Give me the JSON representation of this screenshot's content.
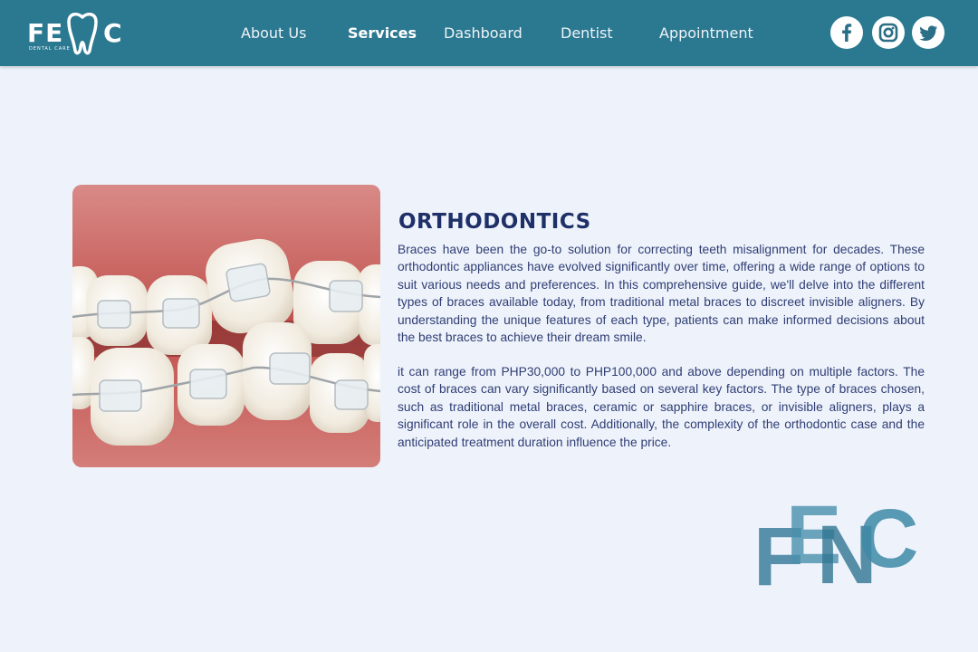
{
  "brand": {
    "logo_left": "FE",
    "logo_right": "C",
    "logo_sub": "DENTAL CARE",
    "watermark": "FENC"
  },
  "nav": {
    "items": [
      {
        "label": "About Us",
        "active": false
      },
      {
        "label": "Services",
        "active": true
      },
      {
        "label": "Dashboard",
        "active": false
      },
      {
        "label": "Dentist",
        "active": false
      },
      {
        "label": "Appointment",
        "active": false
      }
    ]
  },
  "social": [
    "facebook-icon",
    "instagram-icon",
    "twitter-icon"
  ],
  "content": {
    "title": "ORTHODONTICS",
    "paragraph_1": "Braces have been the go-to solution for correcting teeth misalignment for decades. These orthodontic appliances have evolved significantly over time, offering a wide range of options to suit various needs and preferences. In this comprehensive guide, we'll delve into the different types of braces available today, from traditional metal braces to discreet invisible aligners. By understanding the unique features of each type, patients can make informed decisions about the best braces to achieve their dream smile.",
    "paragraph_2": "it can range from PHP30,000 to PHP100,000 and above depending on multiple factors. The cost of braces can vary significantly based on several key factors. The type of braces chosen, such as traditional metal braces, ceramic or sapphire braces, or invisible aligners, plays a significant role in the overall cost. Additionally, the complexity of the orthodontic case and the anticipated treatment duration influence the price."
  },
  "colors": {
    "navbar": "#2b7891",
    "background": "#eef3fb",
    "title": "#1f3069",
    "text": "#2f3d74",
    "social_icon": "#2b6f86"
  }
}
